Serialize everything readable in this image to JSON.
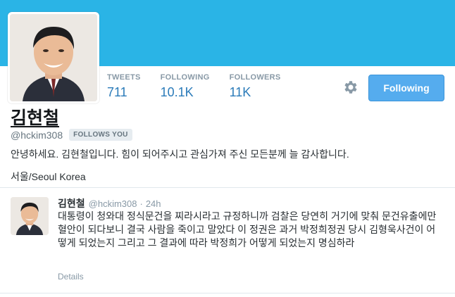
{
  "profile": {
    "name": "김현철",
    "handle": "@hckim308",
    "follows_you": "FOLLOWS YOU",
    "bio": "안녕하세요. 김현철입니다. 힘이 되어주시고 관심가져 주신 모든분께 늘 감사합니다.",
    "location": "서울/Seoul Korea"
  },
  "stats": [
    {
      "label": "TWEETS",
      "value": "711"
    },
    {
      "label": "FOLLOWING",
      "value": "10.1K"
    },
    {
      "label": "FOLLOWERS",
      "value": "11K"
    }
  ],
  "actions": {
    "follow_label": "Following",
    "settings_icon": "gear-icon"
  },
  "tweet": {
    "name": "김현철",
    "handle": "@hckim308",
    "separator": "·",
    "time": "24h",
    "text": "대통령이 청와대 정식문건을 찌라시라고 규정하니까 검찰은 당연히 거기에 맞춰 문건유출에만 혈안이 되다보니 결국 사람을 죽이고 말았다 이 정권은 과거 박정희정권 당시  김형욱사건이 어떻게 되었는지 그리고 그 결과에 따라 박정희가 어떻게 되었는지 명심하라",
    "details_label": "Details"
  },
  "colors": {
    "header_bg": "#2ab4e6",
    "accent": "#55acee",
    "stat_value": "#2b7bb9",
    "muted": "#8899a6"
  }
}
